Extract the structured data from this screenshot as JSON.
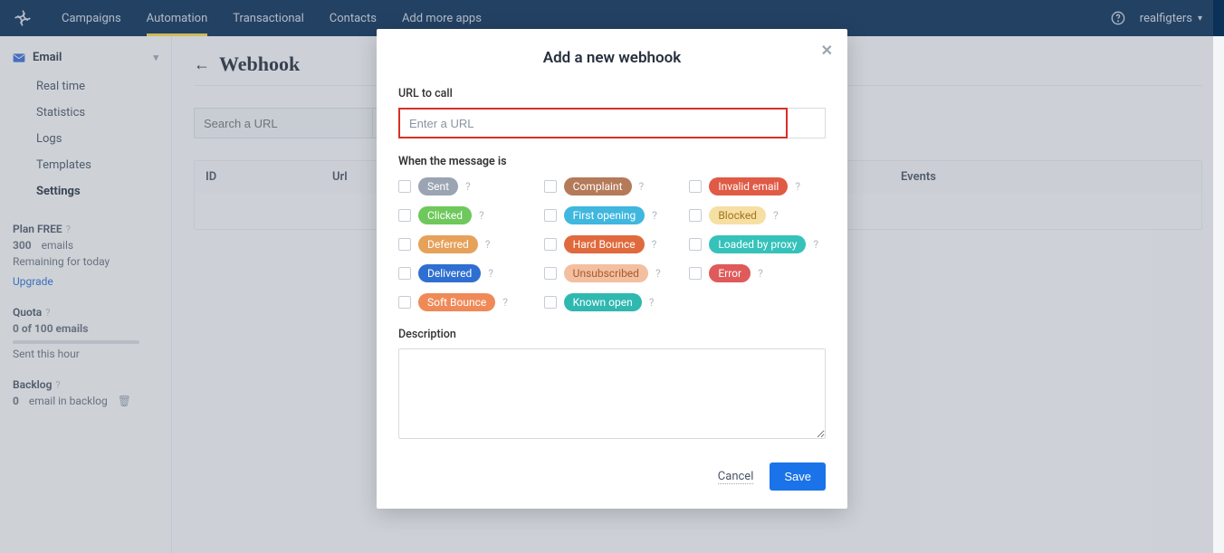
{
  "nav": {
    "items": [
      "Campaigns",
      "Automation",
      "Transactional",
      "Contacts",
      "Add more apps"
    ],
    "active_index": 1,
    "user": "realfigters"
  },
  "sidebar": {
    "section": "Email",
    "items": [
      "Real time",
      "Statistics",
      "Logs",
      "Templates",
      "Settings"
    ],
    "active_index": 4,
    "plan": {
      "label": "Plan FREE",
      "emails_count": "300",
      "emails_suffix": "emails",
      "remaining": "Remaining for today",
      "upgrade": "Upgrade"
    },
    "quota": {
      "label": "Quota",
      "line": "0 of 100 emails",
      "sent": "Sent this hour"
    },
    "backlog": {
      "label": "Backlog",
      "line_count": "0",
      "line_suffix": "email in backlog"
    }
  },
  "page": {
    "title": "Webhook",
    "search_placeholder": "Search a URL",
    "table": {
      "col_id": "ID",
      "col_url": "Url",
      "col_events": "Events"
    }
  },
  "modal": {
    "title": "Add a new webhook",
    "url_label": "URL to call",
    "url_placeholder": "Enter a URL",
    "when_label": "When the message is",
    "events": [
      {
        "label": "Sent",
        "color": "c-gray"
      },
      {
        "label": "Clicked",
        "color": "c-green"
      },
      {
        "label": "Deferred",
        "color": "c-amber"
      },
      {
        "label": "Delivered",
        "color": "c-blue"
      },
      {
        "label": "Soft Bounce",
        "color": "c-orange"
      },
      {
        "label": "Complaint",
        "color": "c-brown"
      },
      {
        "label": "First opening",
        "color": "c-cyan"
      },
      {
        "label": "Hard Bounce",
        "color": "c-orange2"
      },
      {
        "label": "Unsubscribed",
        "color": "c-peach"
      },
      {
        "label": "Known open",
        "color": "c-teal"
      },
      {
        "label": "Invalid email",
        "color": "c-red"
      },
      {
        "label": "Blocked",
        "color": "c-yellow"
      },
      {
        "label": "Loaded by proxy",
        "color": "c-teal2"
      },
      {
        "label": "Error",
        "color": "c-red2"
      }
    ],
    "description_label": "Description",
    "cancel": "Cancel",
    "save": "Save"
  }
}
